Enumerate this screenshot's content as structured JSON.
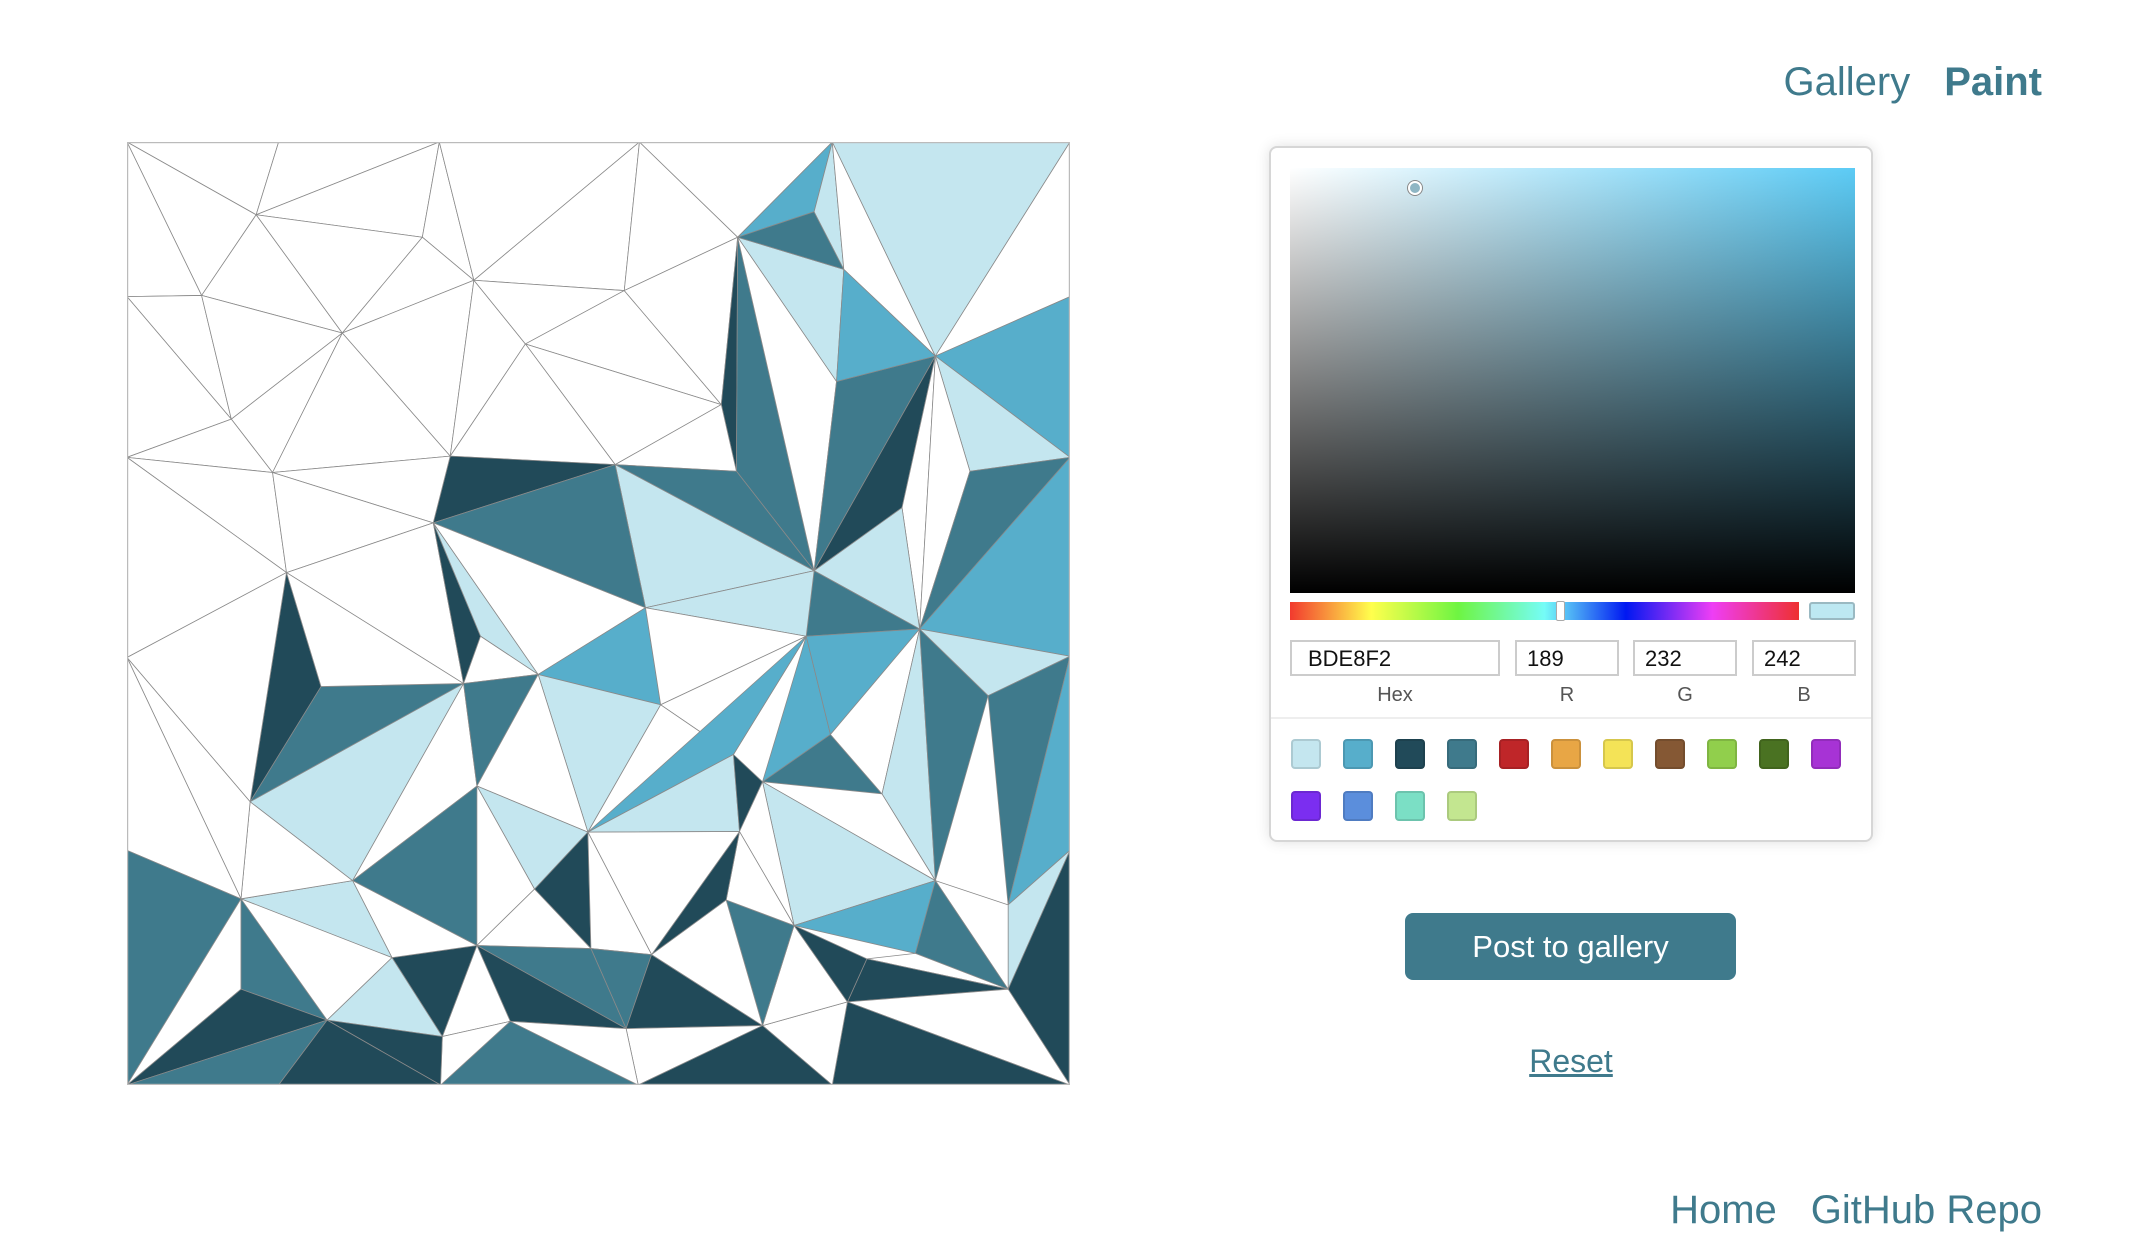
{
  "nav": {
    "gallery": "Gallery",
    "paint": "Paint",
    "active": "Paint"
  },
  "palette_colors": {
    "white": "#ffffff",
    "light": "#c4e6ef",
    "mid": "#57aecb",
    "teal": "#3f7a8c",
    "dark": "#214a59",
    "edge": "#8a8a8a"
  },
  "picker": {
    "hue_color": "#5ccbf5",
    "selected_color": "#BDE8F2",
    "hex": "BDE8F2",
    "r": "189",
    "g": "232",
    "b": "242",
    "labels": {
      "hex": "Hex",
      "r": "R",
      "g": "G",
      "b": "B"
    },
    "swatches": [
      "#c4e6ef",
      "#57aecb",
      "#214a59",
      "#3f7a8c",
      "#bf2629",
      "#e8a645",
      "#f4e357",
      "#855834",
      "#91cf4c",
      "#4a7222",
      "#a733d5",
      "#7b2ef0",
      "#5b8edc",
      "#7bdfc5",
      "#c3e690"
    ]
  },
  "actions": {
    "post": "Post to gallery",
    "reset": "Reset"
  },
  "footer": {
    "home": "Home",
    "github": "GitHub Repo"
  }
}
